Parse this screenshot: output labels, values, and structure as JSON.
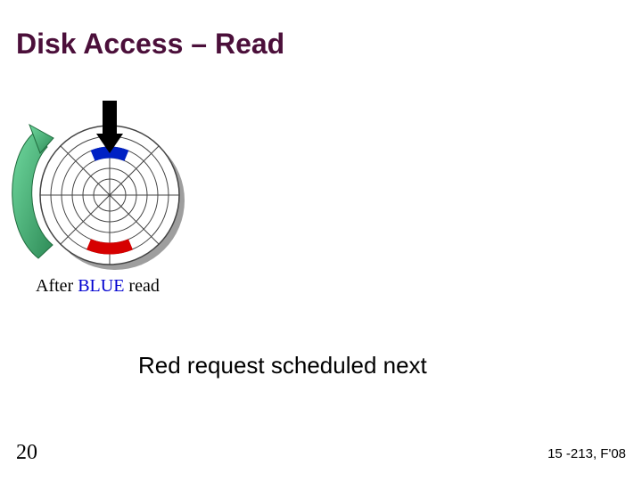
{
  "title": "Disk Access – Read",
  "caption_prefix": "After ",
  "caption_highlight": "BLUE",
  "caption_suffix": " read",
  "body": "Red request scheduled next",
  "page_number": "20",
  "course": "15 -213, F'08",
  "colors": {
    "title": "#4b0f3a",
    "blue_sector": "#0021c4",
    "red_sector": "#d60000",
    "green_arrow_light": "#4fbf7c",
    "green_arrow_dark": "#2e8b57",
    "disk_stroke": "#444444",
    "shadow": "#9e9e9e"
  }
}
